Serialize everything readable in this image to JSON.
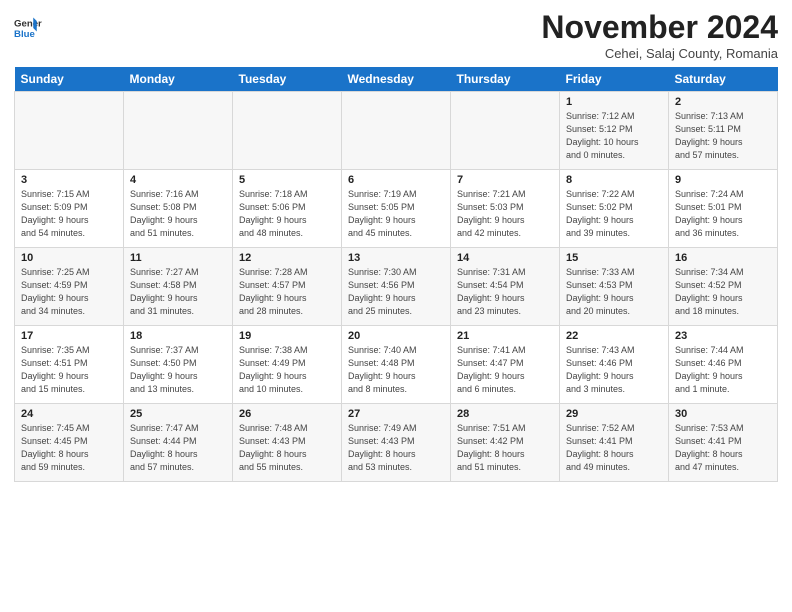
{
  "header": {
    "logo_line1": "General",
    "logo_line2": "Blue",
    "month_title": "November 2024",
    "subtitle": "Cehei, Salaj County, Romania"
  },
  "weekdays": [
    "Sunday",
    "Monday",
    "Tuesday",
    "Wednesday",
    "Thursday",
    "Friday",
    "Saturday"
  ],
  "weeks": [
    [
      {
        "day": "",
        "info": ""
      },
      {
        "day": "",
        "info": ""
      },
      {
        "day": "",
        "info": ""
      },
      {
        "day": "",
        "info": ""
      },
      {
        "day": "",
        "info": ""
      },
      {
        "day": "1",
        "info": "Sunrise: 7:12 AM\nSunset: 5:12 PM\nDaylight: 10 hours\nand 0 minutes."
      },
      {
        "day": "2",
        "info": "Sunrise: 7:13 AM\nSunset: 5:11 PM\nDaylight: 9 hours\nand 57 minutes."
      }
    ],
    [
      {
        "day": "3",
        "info": "Sunrise: 7:15 AM\nSunset: 5:09 PM\nDaylight: 9 hours\nand 54 minutes."
      },
      {
        "day": "4",
        "info": "Sunrise: 7:16 AM\nSunset: 5:08 PM\nDaylight: 9 hours\nand 51 minutes."
      },
      {
        "day": "5",
        "info": "Sunrise: 7:18 AM\nSunset: 5:06 PM\nDaylight: 9 hours\nand 48 minutes."
      },
      {
        "day": "6",
        "info": "Sunrise: 7:19 AM\nSunset: 5:05 PM\nDaylight: 9 hours\nand 45 minutes."
      },
      {
        "day": "7",
        "info": "Sunrise: 7:21 AM\nSunset: 5:03 PM\nDaylight: 9 hours\nand 42 minutes."
      },
      {
        "day": "8",
        "info": "Sunrise: 7:22 AM\nSunset: 5:02 PM\nDaylight: 9 hours\nand 39 minutes."
      },
      {
        "day": "9",
        "info": "Sunrise: 7:24 AM\nSunset: 5:01 PM\nDaylight: 9 hours\nand 36 minutes."
      }
    ],
    [
      {
        "day": "10",
        "info": "Sunrise: 7:25 AM\nSunset: 4:59 PM\nDaylight: 9 hours\nand 34 minutes."
      },
      {
        "day": "11",
        "info": "Sunrise: 7:27 AM\nSunset: 4:58 PM\nDaylight: 9 hours\nand 31 minutes."
      },
      {
        "day": "12",
        "info": "Sunrise: 7:28 AM\nSunset: 4:57 PM\nDaylight: 9 hours\nand 28 minutes."
      },
      {
        "day": "13",
        "info": "Sunrise: 7:30 AM\nSunset: 4:56 PM\nDaylight: 9 hours\nand 25 minutes."
      },
      {
        "day": "14",
        "info": "Sunrise: 7:31 AM\nSunset: 4:54 PM\nDaylight: 9 hours\nand 23 minutes."
      },
      {
        "day": "15",
        "info": "Sunrise: 7:33 AM\nSunset: 4:53 PM\nDaylight: 9 hours\nand 20 minutes."
      },
      {
        "day": "16",
        "info": "Sunrise: 7:34 AM\nSunset: 4:52 PM\nDaylight: 9 hours\nand 18 minutes."
      }
    ],
    [
      {
        "day": "17",
        "info": "Sunrise: 7:35 AM\nSunset: 4:51 PM\nDaylight: 9 hours\nand 15 minutes."
      },
      {
        "day": "18",
        "info": "Sunrise: 7:37 AM\nSunset: 4:50 PM\nDaylight: 9 hours\nand 13 minutes."
      },
      {
        "day": "19",
        "info": "Sunrise: 7:38 AM\nSunset: 4:49 PM\nDaylight: 9 hours\nand 10 minutes."
      },
      {
        "day": "20",
        "info": "Sunrise: 7:40 AM\nSunset: 4:48 PM\nDaylight: 9 hours\nand 8 minutes."
      },
      {
        "day": "21",
        "info": "Sunrise: 7:41 AM\nSunset: 4:47 PM\nDaylight: 9 hours\nand 6 minutes."
      },
      {
        "day": "22",
        "info": "Sunrise: 7:43 AM\nSunset: 4:46 PM\nDaylight: 9 hours\nand 3 minutes."
      },
      {
        "day": "23",
        "info": "Sunrise: 7:44 AM\nSunset: 4:46 PM\nDaylight: 9 hours\nand 1 minute."
      }
    ],
    [
      {
        "day": "24",
        "info": "Sunrise: 7:45 AM\nSunset: 4:45 PM\nDaylight: 8 hours\nand 59 minutes."
      },
      {
        "day": "25",
        "info": "Sunrise: 7:47 AM\nSunset: 4:44 PM\nDaylight: 8 hours\nand 57 minutes."
      },
      {
        "day": "26",
        "info": "Sunrise: 7:48 AM\nSunset: 4:43 PM\nDaylight: 8 hours\nand 55 minutes."
      },
      {
        "day": "27",
        "info": "Sunrise: 7:49 AM\nSunset: 4:43 PM\nDaylight: 8 hours\nand 53 minutes."
      },
      {
        "day": "28",
        "info": "Sunrise: 7:51 AM\nSunset: 4:42 PM\nDaylight: 8 hours\nand 51 minutes."
      },
      {
        "day": "29",
        "info": "Sunrise: 7:52 AM\nSunset: 4:41 PM\nDaylight: 8 hours\nand 49 minutes."
      },
      {
        "day": "30",
        "info": "Sunrise: 7:53 AM\nSunset: 4:41 PM\nDaylight: 8 hours\nand 47 minutes."
      }
    ]
  ]
}
